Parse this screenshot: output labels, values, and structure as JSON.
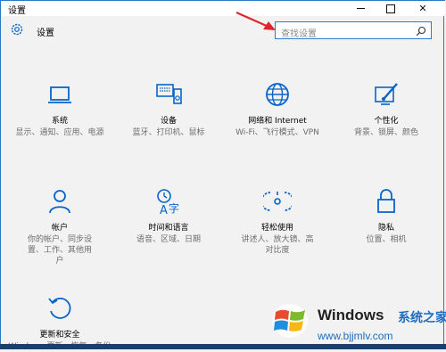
{
  "window": {
    "title": "设置"
  },
  "titlebar": {
    "minimize": "—",
    "maximize": "☐",
    "close": "✕"
  },
  "header": {
    "title": "设置"
  },
  "search": {
    "placeholder": "查找设置"
  },
  "tiles": [
    {
      "name": "系统",
      "desc": "显示、通知、应用、电源",
      "icon": "laptop-icon"
    },
    {
      "name": "设备",
      "desc": "蓝牙、打印机、鼠标",
      "icon": "devices-icon"
    },
    {
      "name": "网络和 Internet",
      "desc": "Wi-Fi、飞行模式、VPN",
      "icon": "globe-icon"
    },
    {
      "name": "个性化",
      "desc": "背景、锁屏、颜色",
      "icon": "personalization-icon"
    },
    {
      "name": "帐户",
      "desc": "你的帐户、同步设置、工作、其他用户",
      "icon": "account-icon"
    },
    {
      "name": "时间和语言",
      "desc": "语音、区域、日期",
      "icon": "time-language-icon"
    },
    {
      "name": "轻松使用",
      "desc": "讲述人、放大镜、高对比度",
      "icon": "ease-of-access-icon"
    },
    {
      "name": "隐私",
      "desc": "位置、相机",
      "icon": "lock-icon"
    },
    {
      "name": "更新和安全",
      "desc": "Windows 更新、恢复、备份",
      "icon": "update-icon"
    }
  ],
  "watermark": {
    "brand": "Windows",
    "cn": "系统之家",
    "url": "www.bjjmlv.com"
  },
  "colors": {
    "accent": "#0078d7",
    "window_bg": "#f2f2f2",
    "border": "#2b79c2"
  }
}
